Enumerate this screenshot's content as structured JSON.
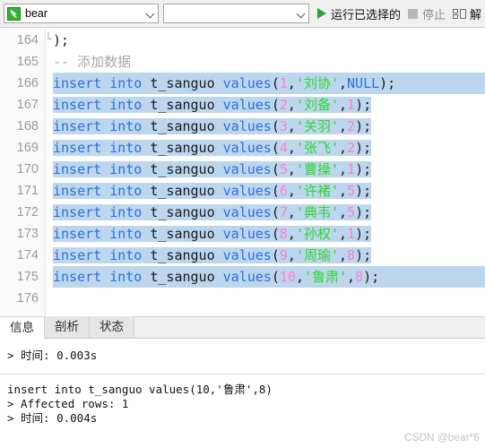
{
  "toolbar": {
    "connection_value": "bear",
    "connection_icon": "database-icon",
    "database_value": "",
    "run_selected_label": "运行已选择的",
    "run_icon": "play-icon",
    "stop_label": "停止",
    "stop_icon": "stop-square-icon",
    "explain_label": "解",
    "explain_icon": "explain-plan-icon",
    "dropdown_icon": "chevron-down-icon"
  },
  "editor": {
    "lines": [
      {
        "no": "164",
        "fold": "└",
        "selected": false,
        "tokens": [
          {
            "t": ");",
            "c": "punc"
          }
        ]
      },
      {
        "no": "165",
        "fold": "",
        "selected": false,
        "tokens": [
          {
            "t": "-- 添加数据",
            "c": "cmt"
          }
        ]
      },
      {
        "no": "166",
        "fold": "",
        "selected": true,
        "selmode": "full",
        "tokens": [
          {
            "t": "insert",
            "c": "kw"
          },
          {
            "t": " ",
            "c": "punc"
          },
          {
            "t": "into",
            "c": "kw"
          },
          {
            "t": " ",
            "c": "punc"
          },
          {
            "t": "t_sanguo",
            "c": "ident"
          },
          {
            "t": " ",
            "c": "punc"
          },
          {
            "t": "values",
            "c": "kw2"
          },
          {
            "t": "(",
            "c": "punc"
          },
          {
            "t": "1",
            "c": "num"
          },
          {
            "t": ",",
            "c": "punc"
          },
          {
            "t": "'刘协'",
            "c": "str"
          },
          {
            "t": ",",
            "c": "punc"
          },
          {
            "t": "NULL",
            "c": "nul"
          },
          {
            "t": ");",
            "c": "punc"
          }
        ]
      },
      {
        "no": "167",
        "fold": "",
        "selected": true,
        "selmode": "fit",
        "tokens": [
          {
            "t": "insert",
            "c": "kw"
          },
          {
            "t": " ",
            "c": "punc"
          },
          {
            "t": "into",
            "c": "kw"
          },
          {
            "t": " ",
            "c": "punc"
          },
          {
            "t": "t_sanguo",
            "c": "ident"
          },
          {
            "t": " ",
            "c": "punc"
          },
          {
            "t": "values",
            "c": "kw2"
          },
          {
            "t": "(",
            "c": "punc"
          },
          {
            "t": "2",
            "c": "num"
          },
          {
            "t": ",",
            "c": "punc"
          },
          {
            "t": "'刘备'",
            "c": "str"
          },
          {
            "t": ",",
            "c": "punc"
          },
          {
            "t": "1",
            "c": "num"
          },
          {
            "t": ");",
            "c": "punc"
          }
        ]
      },
      {
        "no": "168",
        "fold": "",
        "selected": true,
        "selmode": "fit",
        "tokens": [
          {
            "t": "insert",
            "c": "kw"
          },
          {
            "t": " ",
            "c": "punc"
          },
          {
            "t": "into",
            "c": "kw"
          },
          {
            "t": " ",
            "c": "punc"
          },
          {
            "t": "t_sanguo",
            "c": "ident"
          },
          {
            "t": " ",
            "c": "punc"
          },
          {
            "t": "values",
            "c": "kw2"
          },
          {
            "t": "(",
            "c": "punc"
          },
          {
            "t": "3",
            "c": "num"
          },
          {
            "t": ",",
            "c": "punc"
          },
          {
            "t": "'关羽'",
            "c": "str"
          },
          {
            "t": ",",
            "c": "punc"
          },
          {
            "t": "2",
            "c": "num"
          },
          {
            "t": ");",
            "c": "punc"
          }
        ]
      },
      {
        "no": "169",
        "fold": "",
        "selected": true,
        "selmode": "fit",
        "tokens": [
          {
            "t": "insert",
            "c": "kw"
          },
          {
            "t": " ",
            "c": "punc"
          },
          {
            "t": "into",
            "c": "kw"
          },
          {
            "t": " ",
            "c": "punc"
          },
          {
            "t": "t_sanguo",
            "c": "ident"
          },
          {
            "t": " ",
            "c": "punc"
          },
          {
            "t": "values",
            "c": "kw2"
          },
          {
            "t": "(",
            "c": "punc"
          },
          {
            "t": "4",
            "c": "num"
          },
          {
            "t": ",",
            "c": "punc"
          },
          {
            "t": "'张飞'",
            "c": "str"
          },
          {
            "t": ",",
            "c": "punc"
          },
          {
            "t": "2",
            "c": "num"
          },
          {
            "t": ");",
            "c": "punc"
          }
        ]
      },
      {
        "no": "170",
        "fold": "",
        "selected": true,
        "selmode": "fit",
        "tokens": [
          {
            "t": "insert",
            "c": "kw"
          },
          {
            "t": " ",
            "c": "punc"
          },
          {
            "t": "into",
            "c": "kw"
          },
          {
            "t": " ",
            "c": "punc"
          },
          {
            "t": "t_sanguo",
            "c": "ident"
          },
          {
            "t": " ",
            "c": "punc"
          },
          {
            "t": "values",
            "c": "kw2"
          },
          {
            "t": "(",
            "c": "punc"
          },
          {
            "t": "5",
            "c": "num"
          },
          {
            "t": ",",
            "c": "punc"
          },
          {
            "t": "'曹操'",
            "c": "str"
          },
          {
            "t": ",",
            "c": "punc"
          },
          {
            "t": "1",
            "c": "num"
          },
          {
            "t": ");",
            "c": "punc"
          }
        ]
      },
      {
        "no": "171",
        "fold": "",
        "selected": true,
        "selmode": "fit",
        "tokens": [
          {
            "t": "insert",
            "c": "kw"
          },
          {
            "t": " ",
            "c": "punc"
          },
          {
            "t": "into",
            "c": "kw"
          },
          {
            "t": " ",
            "c": "punc"
          },
          {
            "t": "t_sanguo",
            "c": "ident"
          },
          {
            "t": " ",
            "c": "punc"
          },
          {
            "t": "values",
            "c": "kw2"
          },
          {
            "t": "(",
            "c": "punc"
          },
          {
            "t": "6",
            "c": "num"
          },
          {
            "t": ",",
            "c": "punc"
          },
          {
            "t": "'许褚'",
            "c": "str"
          },
          {
            "t": ",",
            "c": "punc"
          },
          {
            "t": "5",
            "c": "num"
          },
          {
            "t": ");",
            "c": "punc"
          }
        ]
      },
      {
        "no": "172",
        "fold": "",
        "selected": true,
        "selmode": "fit",
        "tokens": [
          {
            "t": "insert",
            "c": "kw"
          },
          {
            "t": " ",
            "c": "punc"
          },
          {
            "t": "into",
            "c": "kw"
          },
          {
            "t": " ",
            "c": "punc"
          },
          {
            "t": "t_sanguo",
            "c": "ident"
          },
          {
            "t": " ",
            "c": "punc"
          },
          {
            "t": "values",
            "c": "kw2"
          },
          {
            "t": "(",
            "c": "punc"
          },
          {
            "t": "7",
            "c": "num"
          },
          {
            "t": ",",
            "c": "punc"
          },
          {
            "t": "'典韦'",
            "c": "str"
          },
          {
            "t": ",",
            "c": "punc"
          },
          {
            "t": "5",
            "c": "num"
          },
          {
            "t": ");",
            "c": "punc"
          }
        ]
      },
      {
        "no": "173",
        "fold": "",
        "selected": true,
        "selmode": "fit",
        "tokens": [
          {
            "t": "insert",
            "c": "kw"
          },
          {
            "t": " ",
            "c": "punc"
          },
          {
            "t": "into",
            "c": "kw"
          },
          {
            "t": " ",
            "c": "punc"
          },
          {
            "t": "t_sanguo",
            "c": "ident"
          },
          {
            "t": " ",
            "c": "punc"
          },
          {
            "t": "values",
            "c": "kw2"
          },
          {
            "t": "(",
            "c": "punc"
          },
          {
            "t": "8",
            "c": "num"
          },
          {
            "t": ",",
            "c": "punc"
          },
          {
            "t": "'孙权'",
            "c": "str"
          },
          {
            "t": ",",
            "c": "punc"
          },
          {
            "t": "1",
            "c": "num"
          },
          {
            "t": ");",
            "c": "punc"
          }
        ]
      },
      {
        "no": "174",
        "fold": "",
        "selected": true,
        "selmode": "fit",
        "tokens": [
          {
            "t": "insert",
            "c": "kw"
          },
          {
            "t": " ",
            "c": "punc"
          },
          {
            "t": "into",
            "c": "kw"
          },
          {
            "t": " ",
            "c": "punc"
          },
          {
            "t": "t_sanguo",
            "c": "ident"
          },
          {
            "t": " ",
            "c": "punc"
          },
          {
            "t": "values",
            "c": "kw2"
          },
          {
            "t": "(",
            "c": "punc"
          },
          {
            "t": "9",
            "c": "num"
          },
          {
            "t": ",",
            "c": "punc"
          },
          {
            "t": "'周瑜'",
            "c": "str"
          },
          {
            "t": ",",
            "c": "punc"
          },
          {
            "t": "8",
            "c": "num"
          },
          {
            "t": ");",
            "c": "punc"
          }
        ]
      },
      {
        "no": "175",
        "fold": "",
        "selected": true,
        "selmode": "full",
        "tokens": [
          {
            "t": "insert",
            "c": "kw"
          },
          {
            "t": " ",
            "c": "punc"
          },
          {
            "t": "into",
            "c": "kw"
          },
          {
            "t": " ",
            "c": "punc"
          },
          {
            "t": "t_sanguo",
            "c": "ident"
          },
          {
            "t": " ",
            "c": "punc"
          },
          {
            "t": "values",
            "c": "kw2"
          },
          {
            "t": "(",
            "c": "punc"
          },
          {
            "t": "10",
            "c": "num"
          },
          {
            "t": ",",
            "c": "punc"
          },
          {
            "t": "'鲁肃'",
            "c": "str"
          },
          {
            "t": ",",
            "c": "punc"
          },
          {
            "t": "8",
            "c": "num"
          },
          {
            "t": ");",
            "c": "punc"
          }
        ]
      },
      {
        "no": "176",
        "fold": "",
        "selected": false,
        "tokens": []
      }
    ]
  },
  "bottom": {
    "tabs": [
      {
        "label": "信息",
        "active": true
      },
      {
        "label": "剖析",
        "active": false
      },
      {
        "label": "状态",
        "active": false
      }
    ],
    "status_text": "> 时间: 0.003s",
    "output_lines": [
      "insert into t_sanguo values(10,'鲁肃',8)",
      "> Affected rows: 1",
      "> 时间: 0.004s"
    ]
  },
  "watermark": "CSDN @bear*6"
}
